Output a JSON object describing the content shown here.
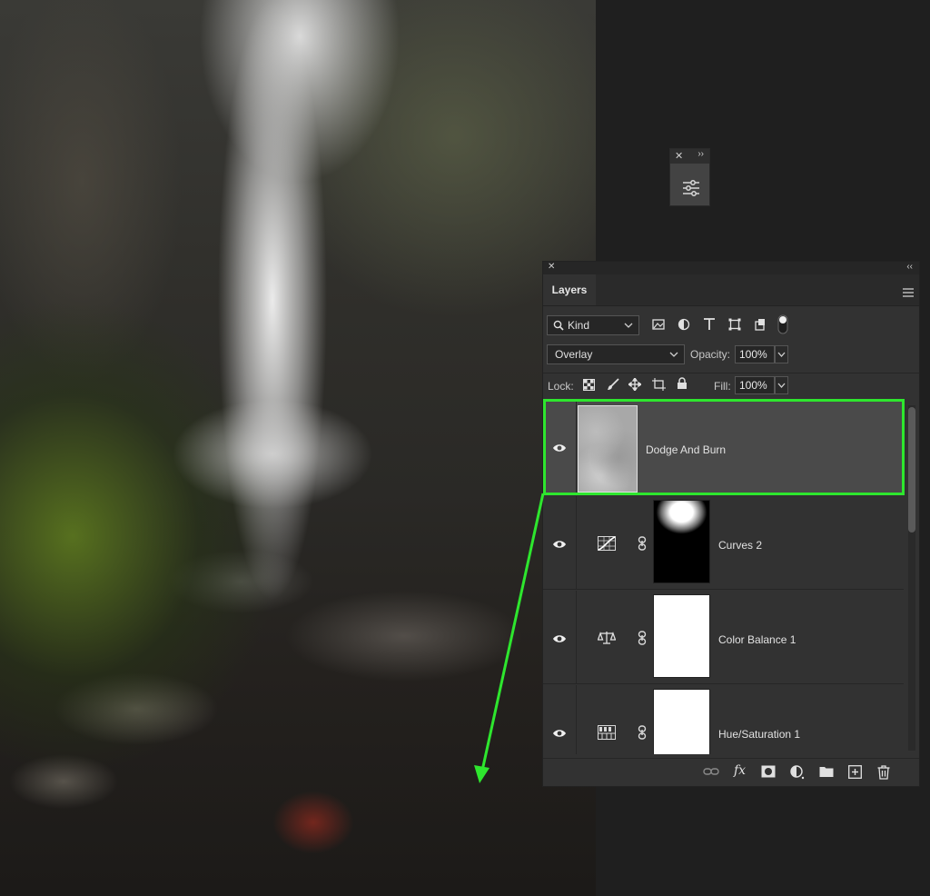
{
  "panel": {
    "tab_label": "Layers"
  },
  "filter": {
    "kind_label": "Kind"
  },
  "blend": {
    "mode": "Overlay",
    "opacity_label": "Opacity:",
    "opacity_value": "100%"
  },
  "lock": {
    "label": "Lock:",
    "fill_label": "Fill:",
    "fill_value": "100%"
  },
  "layers": [
    {
      "name": "Dodge And Burn",
      "selected": true,
      "icon": "gray-noise-thumbnail"
    },
    {
      "name": "Curves 2",
      "selected": false,
      "icon": "curves-icon"
    },
    {
      "name": "Color Balance 1",
      "selected": false,
      "icon": "color-balance-icon"
    },
    {
      "name": "Hue/Saturation 1",
      "selected": false,
      "icon": "hue-saturation-icon"
    }
  ],
  "colors": {
    "highlight": "#2ee62e",
    "panel_bg": "#323232",
    "selected_row": "#4a4a4a"
  }
}
